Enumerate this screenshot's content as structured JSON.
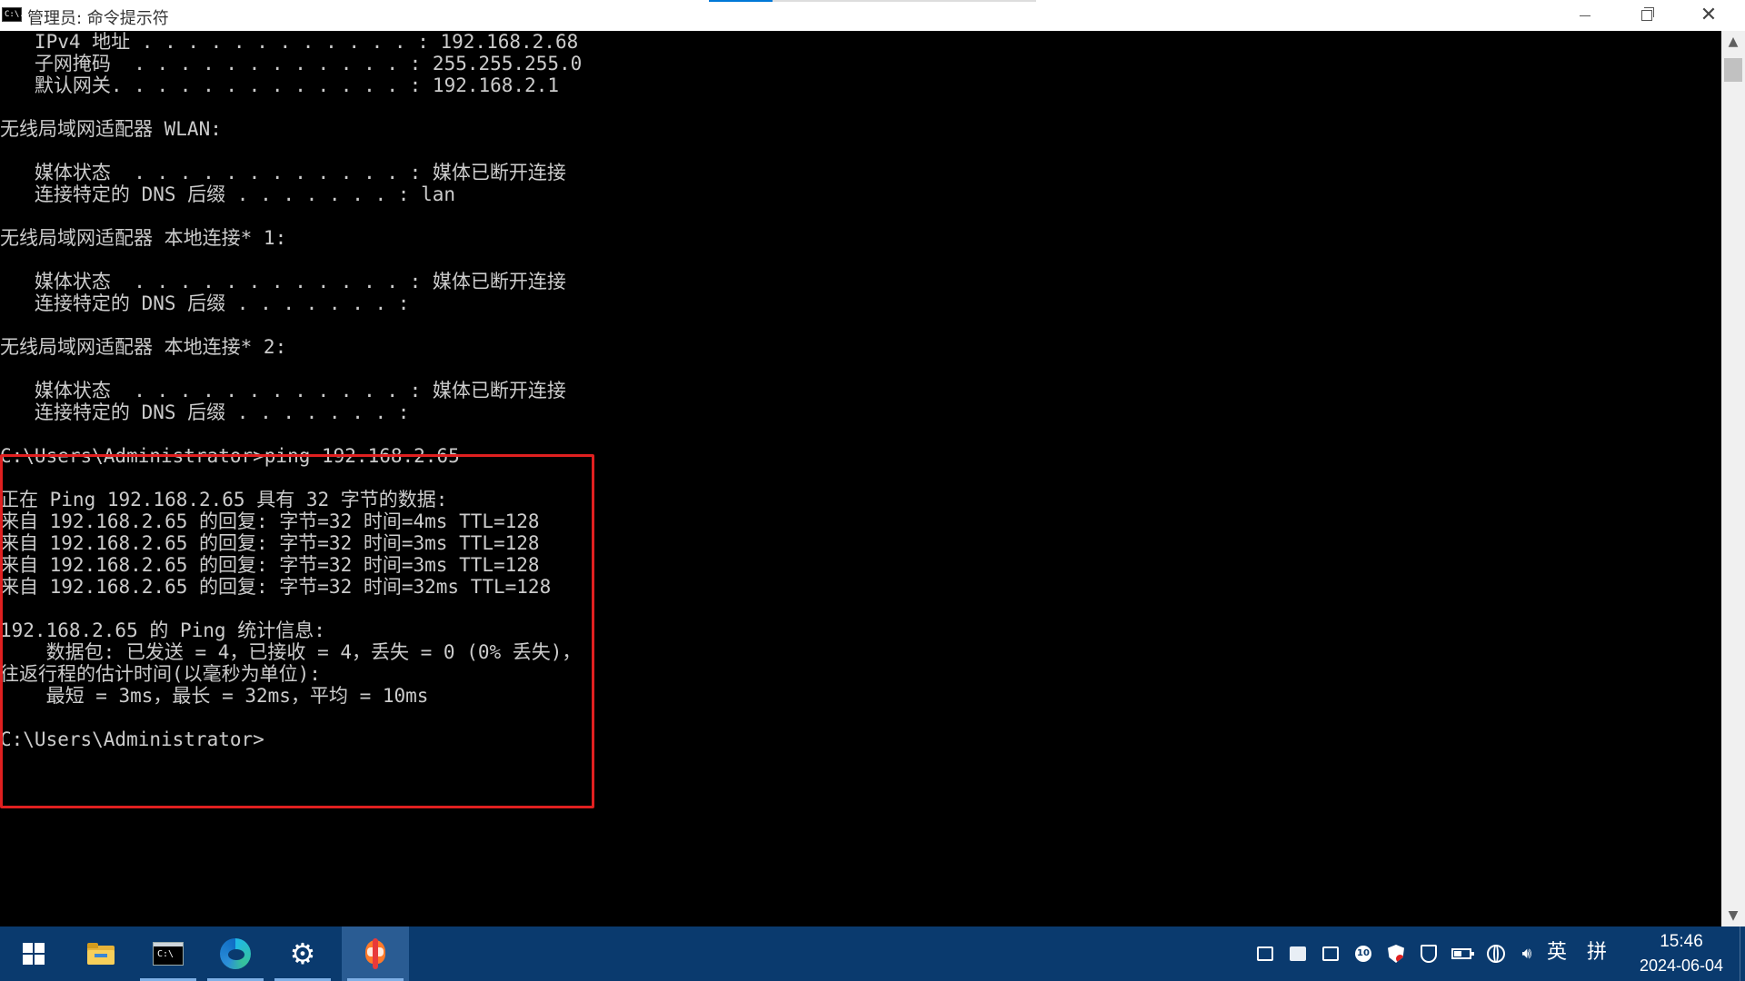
{
  "window": {
    "title": "管理员: 命令提示符",
    "icon_text": "C:\\."
  },
  "console": {
    "lines": [
      "   IPv4 地址 . . . . . . . . . . . . : 192.168.2.68",
      "   子网掩码  . . . . . . . . . . . . : 255.255.255.0",
      "   默认网关. . . . . . . . . . . . . : 192.168.2.1",
      "",
      "无线局域网适配器 WLAN:",
      "",
      "   媒体状态  . . . . . . . . . . . . : 媒体已断开连接",
      "   连接特定的 DNS 后缀 . . . . . . . : lan",
      "",
      "无线局域网适配器 本地连接* 1:",
      "",
      "   媒体状态  . . . . . . . . . . . . : 媒体已断开连接",
      "   连接特定的 DNS 后缀 . . . . . . . :",
      "",
      "无线局域网适配器 本地连接* 2:",
      "",
      "   媒体状态  . . . . . . . . . . . . : 媒体已断开连接",
      "   连接特定的 DNS 后缀 . . . . . . . :",
      "",
      "C:\\Users\\Administrator>ping 192.168.2.65",
      "",
      "正在 Ping 192.168.2.65 具有 32 字节的数据:",
      "来自 192.168.2.65 的回复: 字节=32 时间=4ms TTL=128",
      "来自 192.168.2.65 的回复: 字节=32 时间=3ms TTL=128",
      "来自 192.168.2.65 的回复: 字节=32 时间=3ms TTL=128",
      "来自 192.168.2.65 的回复: 字节=32 时间=32ms TTL=128",
      "",
      "192.168.2.65 的 Ping 统计信息:",
      "    数据包: 已发送 = 4，已接收 = 4，丢失 = 0 (0% 丢失)，",
      "往返行程的估计时间(以毫秒为单位):",
      "    最短 = 3ms，最长 = 32ms，平均 = 10ms",
      "",
      "C:\\Users\\Administrator>"
    ]
  },
  "taskbar": {
    "apps": [
      {
        "name": "start",
        "icon": "windows-logo-icon"
      },
      {
        "name": "file-explorer",
        "icon": "folder-icon"
      },
      {
        "name": "command-prompt",
        "icon": "terminal-icon"
      },
      {
        "name": "edge",
        "icon": "edge-icon"
      },
      {
        "name": "settings",
        "icon": "gear-icon"
      },
      {
        "name": "pinned-app",
        "icon": "app-icon"
      }
    ],
    "tray": {
      "icon_10_label": "10",
      "ime_lang": "英",
      "ime_mode": "拼"
    },
    "clock": {
      "time": "15:46",
      "date": "2024-06-04"
    }
  },
  "colors": {
    "console_bg": "#000000",
    "console_text": "#cccccc",
    "highlight": "#e02020",
    "taskbar_bg": "#0a3a6e",
    "accent": "#0078d7"
  }
}
